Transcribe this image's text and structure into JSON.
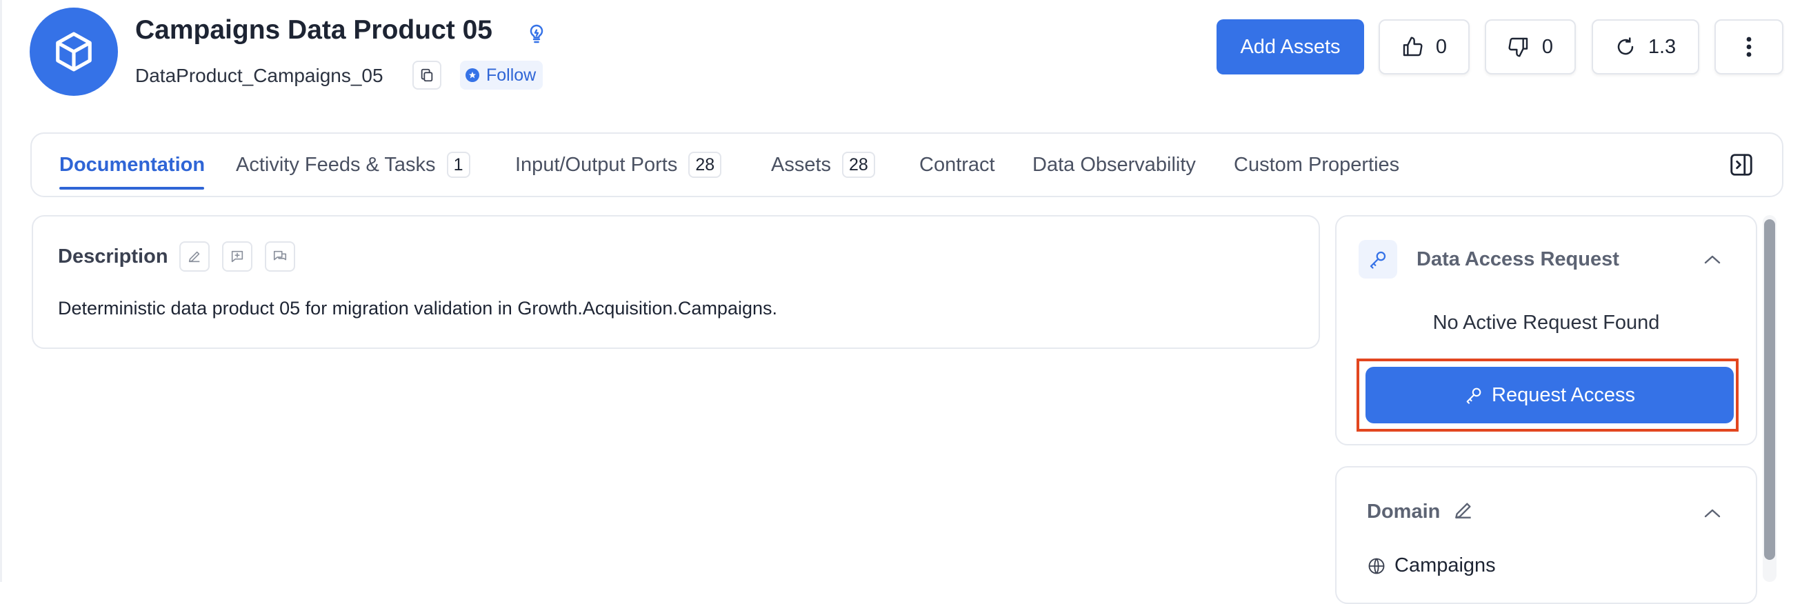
{
  "header": {
    "title": "Campaigns Data Product 05",
    "subtitle": "DataProduct_Campaigns_05",
    "follow_label": "Follow",
    "add_assets_label": "Add Assets",
    "likes": "0",
    "dislikes": "0",
    "version": "1.3"
  },
  "tabs": [
    {
      "label": "Documentation",
      "active": true
    },
    {
      "label": "Activity Feeds & Tasks",
      "count": "1"
    },
    {
      "label": "Input/Output Ports",
      "count": "28"
    },
    {
      "label": "Assets",
      "count": "28"
    },
    {
      "label": "Contract"
    },
    {
      "label": "Data Observability"
    },
    {
      "label": "Custom Properties"
    }
  ],
  "description": {
    "title": "Description",
    "text": "Deterministic data product 05 for migration validation in Growth.Acquisition.Campaigns."
  },
  "access_request": {
    "title": "Data Access Request",
    "status": "No Active Request Found",
    "button_label": "Request Access"
  },
  "domain": {
    "title": "Domain",
    "value": "Campaigns"
  },
  "colors": {
    "primary": "#3572e7",
    "highlight": "#e2461f"
  },
  "icons": {
    "avatar": "cube-icon",
    "bulb": "lightbulb-icon",
    "copy": "copy-icon",
    "like": "thumbs-up-icon",
    "dislike": "thumbs-down-icon",
    "version": "history-icon",
    "more": "more-vertical-icon",
    "panel": "panel-toggle-icon",
    "key": "key-icon",
    "globe": "globe-icon"
  }
}
